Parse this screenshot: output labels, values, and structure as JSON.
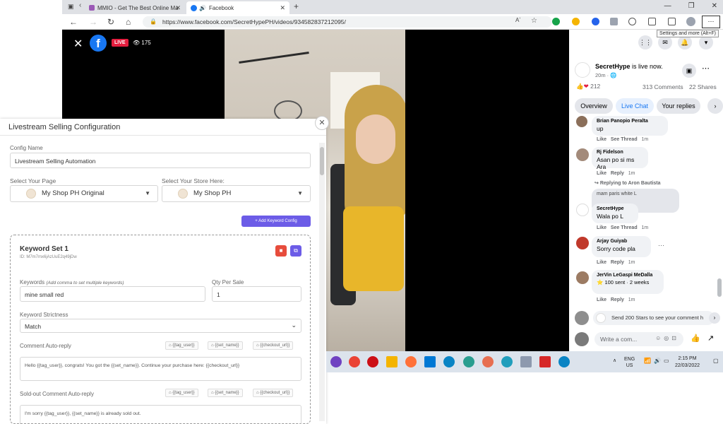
{
  "browser": {
    "tabs": [
      {
        "title": "MMIO - Get The Best Online Ma"
      },
      {
        "title": "Facebook"
      }
    ],
    "url": "https://www.facebook.com/SecretHypePH/videos/934582837212095/",
    "tooltip": "Settings and more (Alt+F)"
  },
  "video": {
    "live_label": "LIVE",
    "viewers": "175"
  },
  "panel": {
    "title": "Livestream Selling Configuration",
    "config_name_label": "Config Name",
    "config_name_value": "Livestream Selling Automation",
    "page_label": "Select Your Page",
    "page_value": "My Shop PH Original",
    "store_label": "Select Your Store Here:",
    "store_value": "My Shop PH",
    "add_keyword_btn": "Add Keyword Config",
    "keyword_set": {
      "title": "Keyword Set 1",
      "id": "ID: M7m7mx6jAzUuE2q49jDw",
      "keywords_label": "Keywords",
      "keywords_hint": "(Add comma to set multiple keywords)",
      "keywords_value": "mine small red",
      "qty_label": "Qty Per Sale",
      "qty_value": "1",
      "strictness_label": "Keyword Strictness",
      "strictness_value": "Match",
      "comment_label": "Comment Auto-reply",
      "tags": [
        "{{tag_user}}",
        "{{set_name}}",
        "{{checkout_url}}"
      ],
      "comment_value": "Hello {{tag_user}}, congrats! You got the {{set_name}}. Continue your purchase here: {{checkout_url}}",
      "soldout_label": "Sold-out Comment Auto-reply",
      "soldout_value": "I'm sorry {{tag_user}}, {{set_name}} is already sold out."
    }
  },
  "taskbar": {
    "lang": "ENG",
    "region": "US",
    "time": "2:15 PM",
    "date": "22/03/2022"
  },
  "fb": {
    "page_name": "SecretHype",
    "status": "is live now.",
    "time_ago": "20m",
    "reactions": "212",
    "comments": "313 Comments",
    "shares": "22 Shares",
    "tabs": [
      "Overview",
      "Live Chat",
      "Your replies"
    ],
    "comments_list": [
      {
        "name": "Brian Panopio Peralta",
        "text": "up",
        "actions": [
          "Like",
          "See Thread",
          "1m"
        ]
      },
      {
        "name": "Rj Fidelson",
        "text": "Asan po si ms Ara",
        "actions": [
          "Like",
          "Reply",
          "1m"
        ]
      },
      {
        "reply_note": "Replying to Aron Bautista",
        "quoted": "mam paris white L",
        "name": "SecretHype",
        "text": "Wala po L",
        "actions": [
          "Like",
          "See Thread",
          "1m"
        ]
      },
      {
        "name": "Arjay Guiyab",
        "text": "Sorry code pla",
        "actions": [
          "Like",
          "Reply",
          "1m"
        ]
      },
      {
        "name": "JerVin LeGaspi MeDalla",
        "text": "100 sent · 2 weeks",
        "actions": [
          "Like",
          "Reply",
          "1m"
        ]
      }
    ],
    "stars_prompt": "Send 200 Stars to see your comment h",
    "write_placeholder": "Write a com..."
  },
  "colors": {
    "fb_blue": "#1877f2",
    "live_red": "#e41e3f",
    "purple": "#6c5ce7"
  }
}
